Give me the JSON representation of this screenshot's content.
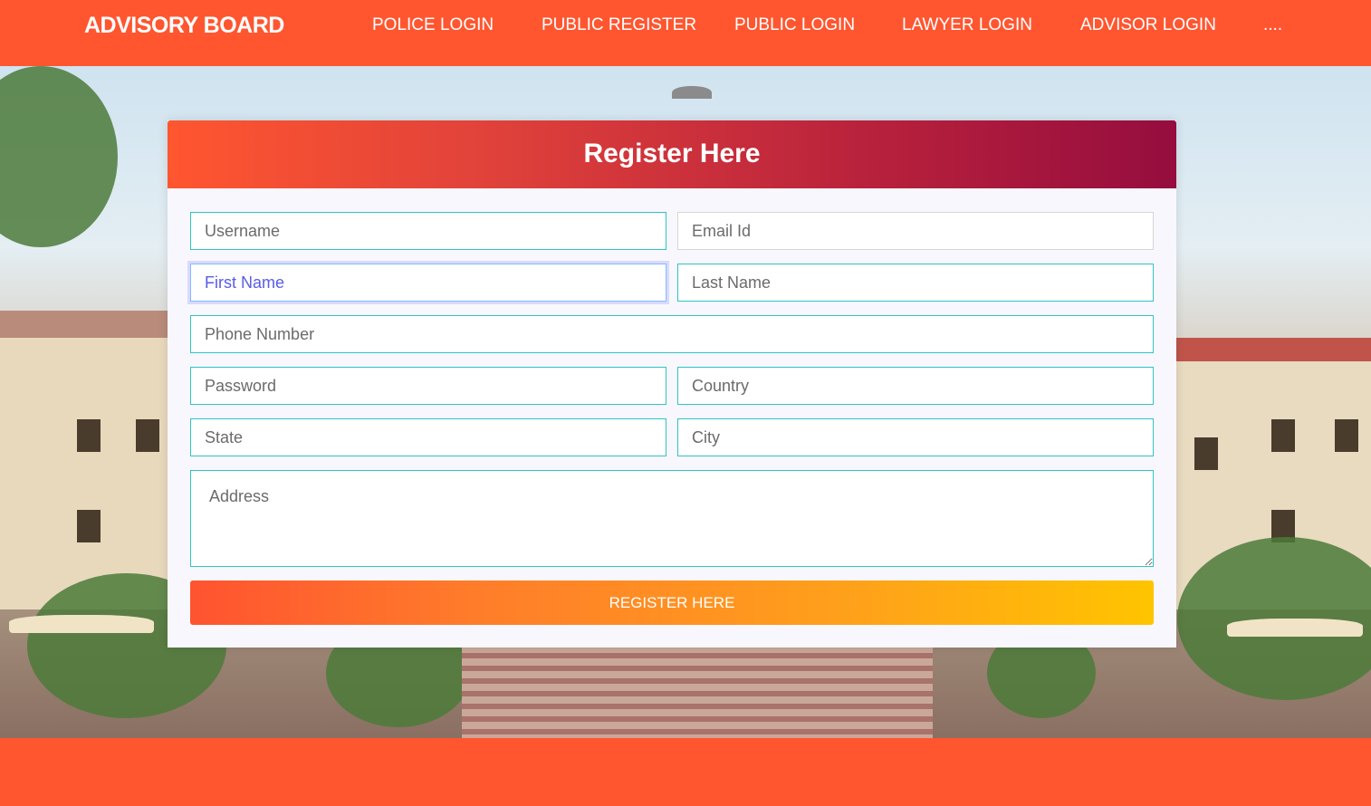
{
  "navbar": {
    "brand": "ADVISORY BOARD",
    "links": [
      "POLICE LOGIN",
      "PUBLIC REGISTER",
      "PUBLIC LOGIN",
      "LAWYER LOGIN",
      "ADVISOR LOGIN",
      "...."
    ]
  },
  "colors": {
    "accent": "#ff5630",
    "header_gradient_end": "#950d3e",
    "button_gradient_end": "#ffc400",
    "field_border": "#2ec4c4"
  },
  "form": {
    "title": "Register Here",
    "placeholders": {
      "username": "Username",
      "email": "Email Id",
      "first_name": "First Name",
      "last_name": "Last Name",
      "phone": "Phone Number",
      "password": "Password",
      "country": "Country",
      "state": "State",
      "city": "City",
      "address": "Address"
    },
    "submit_label": "REGISTER HERE"
  }
}
